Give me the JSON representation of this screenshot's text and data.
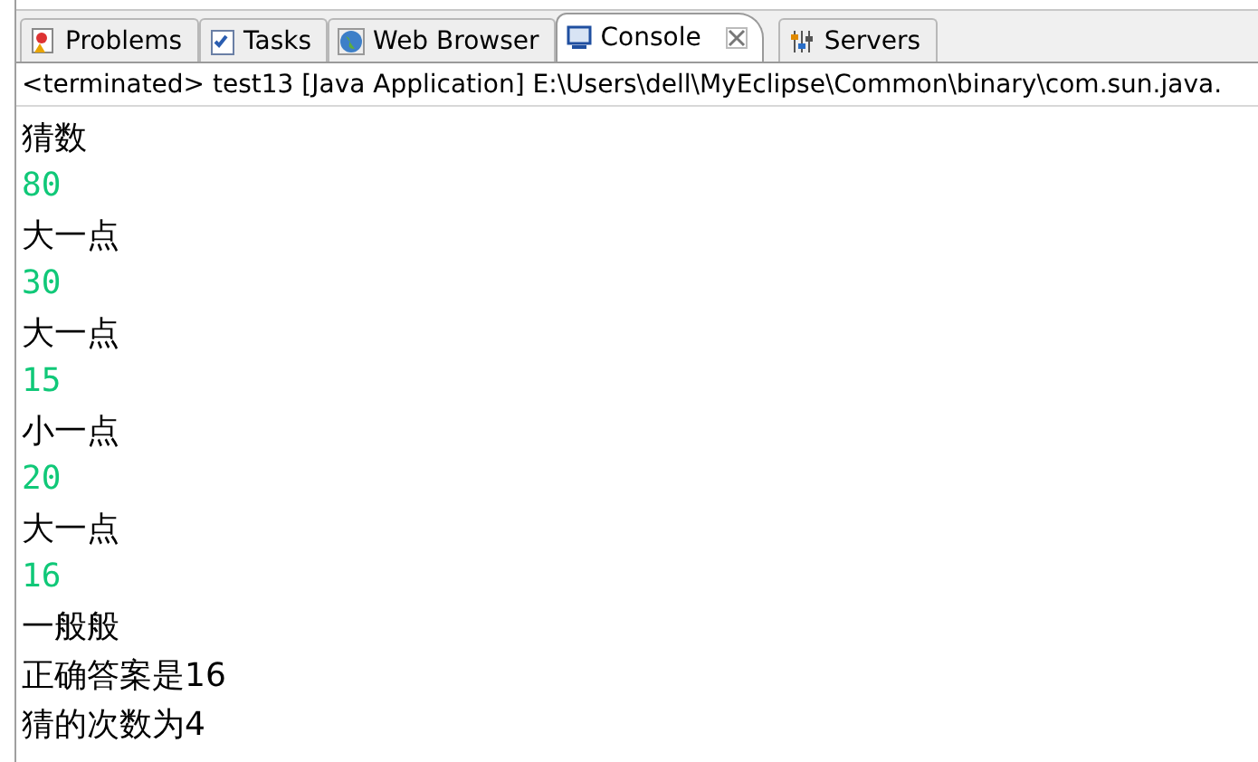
{
  "tabs": [
    {
      "label": "Problems",
      "kind": "problems",
      "selected": false
    },
    {
      "label": "Tasks",
      "kind": "tasks",
      "selected": false
    },
    {
      "label": "Web Browser",
      "kind": "browser",
      "selected": false
    },
    {
      "label": "Console",
      "kind": "console",
      "selected": true
    },
    {
      "label": "Servers",
      "kind": "servers",
      "selected": false
    }
  ],
  "console": {
    "header": "<terminated> test13 [Java Application] E:\\Users\\dell\\MyEclipse\\Common\\binary\\com.sun.java.",
    "lines": [
      {
        "text": "猜数",
        "kind": "output"
      },
      {
        "text": "80",
        "kind": "input"
      },
      {
        "text": "大一点",
        "kind": "output"
      },
      {
        "text": "30",
        "kind": "input"
      },
      {
        "text": "大一点",
        "kind": "output"
      },
      {
        "text": "15",
        "kind": "input"
      },
      {
        "text": "小一点",
        "kind": "output"
      },
      {
        "text": "20",
        "kind": "input"
      },
      {
        "text": "大一点",
        "kind": "output"
      },
      {
        "text": "16",
        "kind": "input"
      },
      {
        "text": "一般般",
        "kind": "output"
      },
      {
        "text": "正确答案是16",
        "kind": "output"
      },
      {
        "text": "猜的次数为4",
        "kind": "output"
      }
    ]
  }
}
